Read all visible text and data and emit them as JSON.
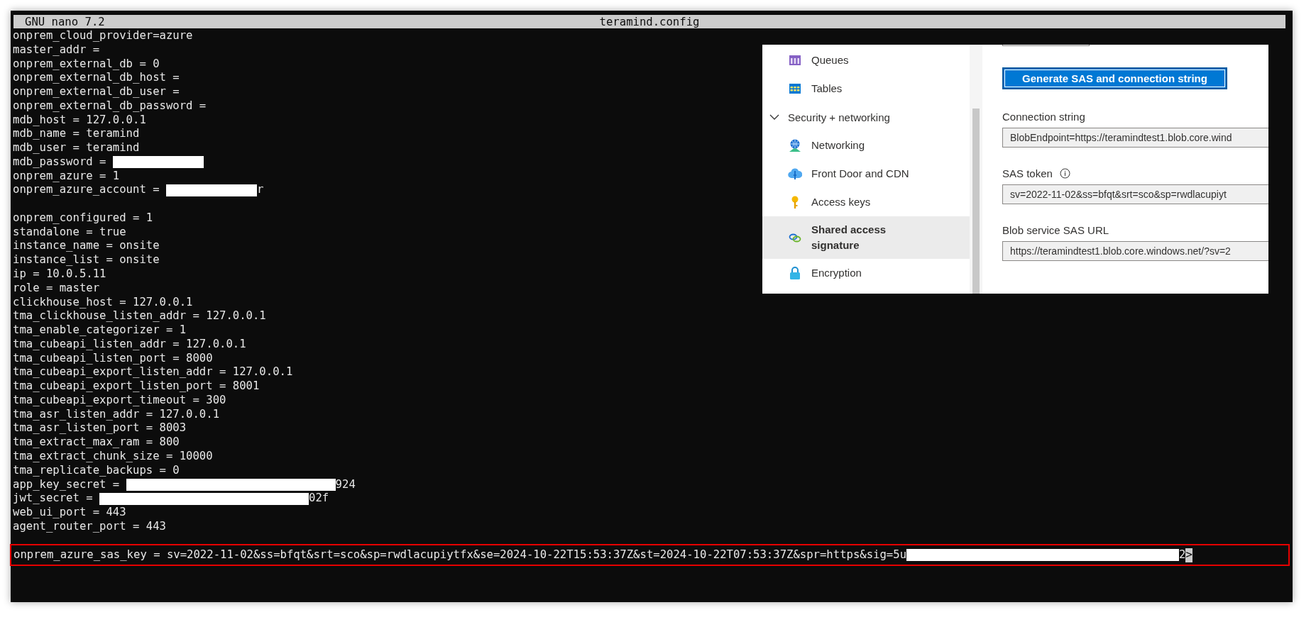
{
  "editor": {
    "app": "GNU nano 7.2",
    "filename": "teramind.config",
    "lines": [
      {
        "kind": "text",
        "text": "onprem_cloud_provider=azure"
      },
      {
        "kind": "text",
        "text": "master_addr ="
      },
      {
        "kind": "text",
        "text": "onprem_external_db = 0"
      },
      {
        "kind": "text",
        "text": "onprem_external_db_host ="
      },
      {
        "kind": "text",
        "text": "onprem_external_db_user ="
      },
      {
        "kind": "text",
        "text": "onprem_external_db_password ="
      },
      {
        "kind": "text",
        "text": "mdb_host = 127.0.0.1"
      },
      {
        "kind": "text",
        "text": "mdb_name = teramind"
      },
      {
        "kind": "text",
        "text": "mdb_user = teramind"
      },
      {
        "kind": "secret",
        "text": "mdb_password = "
      },
      {
        "kind": "text",
        "text": "onprem_azure = 1"
      },
      {
        "kind": "secret",
        "text": "onprem_azure_account = ",
        "tail": "r"
      },
      {
        "kind": "blank"
      },
      {
        "kind": "text",
        "text": "onprem_configured = 1"
      },
      {
        "kind": "text",
        "text": "standalone = true"
      },
      {
        "kind": "text",
        "text": "instance_name = onsite"
      },
      {
        "kind": "text",
        "text": "instance_list = onsite"
      },
      {
        "kind": "text",
        "text": "ip = 10.0.5.11"
      },
      {
        "kind": "text",
        "text": "role = master"
      },
      {
        "kind": "text",
        "text": "clickhouse_host = 127.0.0.1"
      },
      {
        "kind": "text",
        "text": "tma_clickhouse_listen_addr = 127.0.0.1"
      },
      {
        "kind": "text",
        "text": "tma_enable_categorizer = 1"
      },
      {
        "kind": "text",
        "text": "tma_cubeapi_listen_addr = 127.0.0.1"
      },
      {
        "kind": "text",
        "text": "tma_cubeapi_listen_port = 8000"
      },
      {
        "kind": "text",
        "text": "tma_cubeapi_export_listen_addr = 127.0.0.1"
      },
      {
        "kind": "text",
        "text": "tma_cubeapi_export_listen_port = 8001"
      },
      {
        "kind": "text",
        "text": "tma_cubeapi_export_timeout = 300"
      },
      {
        "kind": "text",
        "text": "tma_asr_listen_addr = 127.0.0.1"
      },
      {
        "kind": "text",
        "text": "tma_asr_listen_port = 8003"
      },
      {
        "kind": "text",
        "text": "tma_extract_max_ram = 800"
      },
      {
        "kind": "text",
        "text": "tma_extract_chunk_size = 10000"
      },
      {
        "kind": "text",
        "text": "tma_replicate_backups = 0"
      },
      {
        "kind": "secret",
        "text": "app_key_secret = ",
        "tail": "924"
      },
      {
        "kind": "secret",
        "text": "jwt_secret = ",
        "tail": "02f"
      },
      {
        "kind": "text",
        "text": "web_ui_port = 443"
      },
      {
        "kind": "text",
        "text": "agent_router_port = 443"
      },
      {
        "kind": "blank"
      },
      {
        "text": "onprem_azure_sas_key = sv=2022-11-02&ss=bfqt&srt=sco&sp=rwdlacupiytfx&se=2024-10-22T15:53:37Z&st=2024-10-22T07:53:37Z&spr=https&sig=5u",
        "kind": "secret",
        "tail": "2",
        "more": ">",
        "highlighted": true
      }
    ]
  },
  "azure_panel": {
    "nav": [
      {
        "kind": "item",
        "label": "Queues",
        "selected": false
      },
      {
        "kind": "item",
        "label": "Tables",
        "selected": false
      },
      {
        "kind": "group",
        "label": "Security + networking",
        "expanded": true
      },
      {
        "kind": "item",
        "label": "Networking",
        "selected": false
      },
      {
        "kind": "item",
        "label": "Front Door and CDN",
        "selected": false
      },
      {
        "kind": "item",
        "label": "Access keys",
        "selected": false
      },
      {
        "kind": "item",
        "label": "Shared access signature",
        "selected": true
      },
      {
        "kind": "item",
        "label": "Encryption",
        "selected": false
      }
    ],
    "generate_button": "Generate SAS and connection string",
    "fields": [
      {
        "label": "Connection string",
        "info": false,
        "value": "BlobEndpoint=https://teramindtest1.blob.core.wind"
      },
      {
        "label": "SAS token",
        "info": true,
        "value": "sv=2022-11-02&ss=bfqt&srt=sco&sp=rwdlacupiyt"
      },
      {
        "label": "Blob service SAS URL",
        "info": false,
        "value": "https://teramindtest1.blob.core.windows.net/?sv=2"
      }
    ]
  }
}
